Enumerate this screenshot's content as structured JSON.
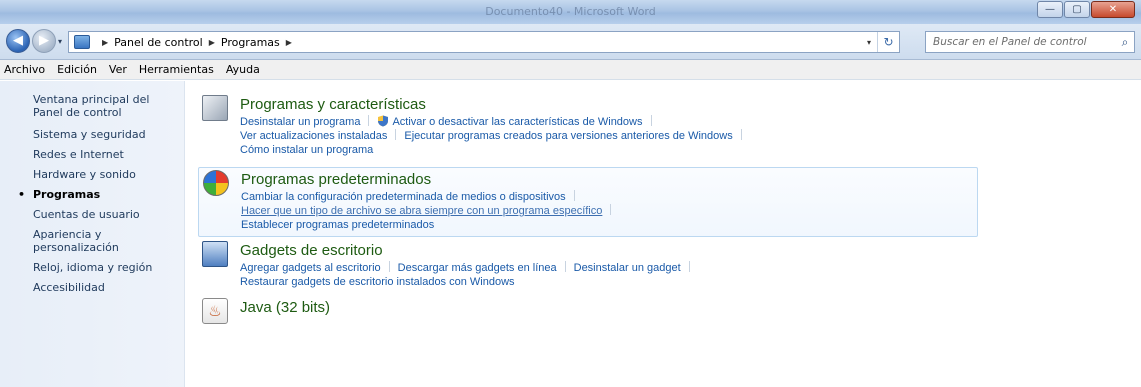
{
  "window": {
    "title": "Documento40 - Microsoft Word",
    "minimize": "—",
    "maximize": "▢",
    "close": "✕"
  },
  "nav": {
    "back_glyph": "◀",
    "forward_glyph": "▶",
    "dropdown_glyph": "▾",
    "breadcrumbs": [
      "Panel de control",
      "Programas"
    ],
    "breadcrumb_sep": "▶",
    "refresh_glyph": "↻",
    "search_placeholder": "Buscar en el Panel de control",
    "search_glyph": "⌕"
  },
  "menu": [
    "Archivo",
    "Edición",
    "Ver",
    "Herramientas",
    "Ayuda"
  ],
  "sidebar": {
    "home": "Ventana principal del Panel de control",
    "items": [
      {
        "label": "Sistema y seguridad",
        "active": false
      },
      {
        "label": "Redes e Internet",
        "active": false
      },
      {
        "label": "Hardware y sonido",
        "active": false
      },
      {
        "label": "Programas",
        "active": true
      },
      {
        "label": "Cuentas de usuario",
        "active": false
      },
      {
        "label": "Apariencia y personalización",
        "active": false
      },
      {
        "label": "Reloj, idioma y región",
        "active": false
      },
      {
        "label": "Accesibilidad",
        "active": false
      }
    ],
    "bullet": "•"
  },
  "categories": {
    "programs": {
      "title": "Programas y características",
      "links_row1": [
        "Desinstalar un programa",
        "Activar o desactivar las características de Windows"
      ],
      "links_row2": [
        "Ver actualizaciones instaladas",
        "Ejecutar programas creados para versiones anteriores de Windows"
      ],
      "links_row3": [
        "Cómo instalar un programa"
      ]
    },
    "defaults": {
      "title": "Programas predeterminados",
      "links_row1": [
        "Cambiar la configuración predeterminada de medios o dispositivos"
      ],
      "links_row2": [
        "Hacer que un tipo de archivo se abra siempre con un programa específico"
      ],
      "links_row3": [
        "Establecer programas predeterminados"
      ]
    },
    "gadgets": {
      "title": "Gadgets de escritorio",
      "links_row1": [
        "Agregar gadgets al escritorio",
        "Descargar más gadgets en línea",
        "Desinstalar un gadget"
      ],
      "links_row2": [
        "Restaurar gadgets de escritorio instalados con Windows"
      ]
    },
    "java": {
      "title": "Java (32 bits)",
      "icon_glyph": "♨"
    }
  },
  "colors": {
    "category_title": "#1e5b12",
    "link": "#1a5aa8",
    "sidebar_bg": "#e7eef8"
  }
}
